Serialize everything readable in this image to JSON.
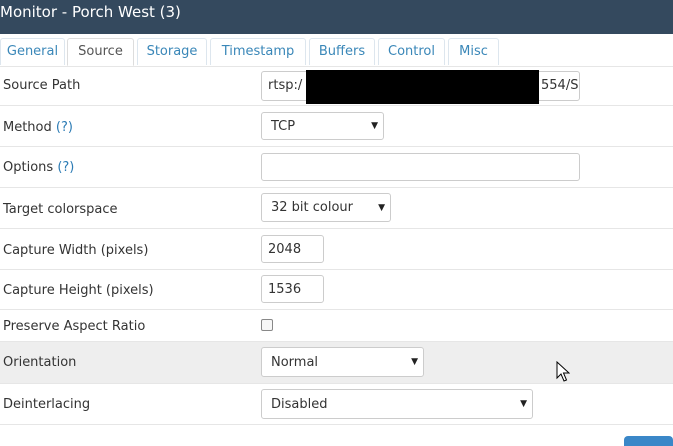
{
  "window": {
    "title": "Monitor - Porch West (3)"
  },
  "tabs": [
    {
      "label": "General"
    },
    {
      "label": "Source"
    },
    {
      "label": "Storage"
    },
    {
      "label": "Timestamp"
    },
    {
      "label": "Buffers"
    },
    {
      "label": "Control"
    },
    {
      "label": "Misc"
    }
  ],
  "active_tab": "Source",
  "form": {
    "source_path": {
      "label": "Source Path",
      "value_prefix": "rtsp:/",
      "value_suffix": "554/S"
    },
    "method": {
      "label": "Method",
      "help": "(?)",
      "value": "TCP"
    },
    "options": {
      "label": "Options",
      "help": "(?)",
      "value": ""
    },
    "target_colorspace": {
      "label": "Target colorspace",
      "value": "32 bit colour"
    },
    "capture_width": {
      "label": "Capture Width (pixels)",
      "value": "2048"
    },
    "capture_height": {
      "label": "Capture Height (pixels)",
      "value": "1536"
    },
    "preserve_aspect_ratio": {
      "label": "Preserve Aspect Ratio",
      "checked": false
    },
    "orientation": {
      "label": "Orientation",
      "value": "Normal"
    },
    "deinterlacing": {
      "label": "Deinterlacing",
      "value": "Disabled"
    }
  },
  "icons": {
    "dropdown": "caret-down-icon",
    "pointer": "mouse-pointer-icon"
  },
  "colors": {
    "header_bg": "#34495e",
    "tab_text": "#3a87b8",
    "help_link": "#2d7cb5"
  }
}
